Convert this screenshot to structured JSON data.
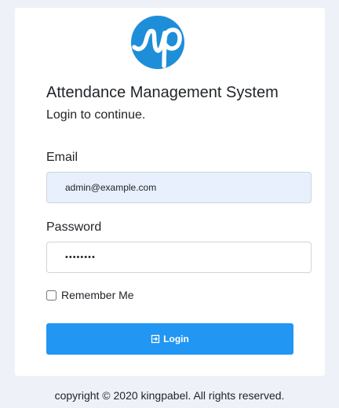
{
  "app": {
    "title": "Attendance Management System",
    "subtitle": "Login to continue."
  },
  "form": {
    "email_label": "Email",
    "email_value": "admin@example.com",
    "password_label": "Password",
    "password_value": "••••••••",
    "remember_label": "Remember Me",
    "remember_checked": false,
    "login_label": "Login"
  },
  "footer": {
    "text": "copyright © 2020 kingpabel. All rights reserved."
  },
  "icons": {
    "logo": "logo-icon",
    "login": "sign-in-icon"
  },
  "colors": {
    "accent": "#2196f3",
    "logo": "#1e8ed8",
    "autofill_background": "#e8f0fe",
    "page_background": "#eef2f8"
  }
}
